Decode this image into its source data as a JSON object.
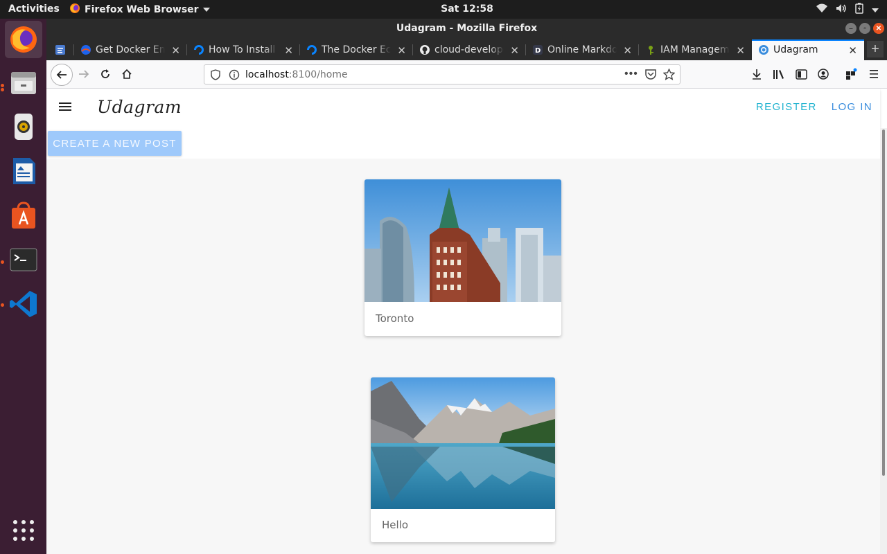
{
  "topbar": {
    "activities": "Activities",
    "app_name": "Firefox Web Browser",
    "clock": "Sat 12:58"
  },
  "window": {
    "title": "Udagram - Mozilla Firefox"
  },
  "tabs": [
    {
      "label": "Get Docker Eng",
      "icon": "docker-docs-icon"
    },
    {
      "label": "How To Install a",
      "icon": "digitalocean-icon"
    },
    {
      "label": "The Docker Eco",
      "icon": "digitalocean-icon"
    },
    {
      "label": "cloud-develope",
      "icon": "github-icon"
    },
    {
      "label": "Online Markdo",
      "icon": "dillinger-icon"
    },
    {
      "label": "IAM Manageme",
      "icon": "aws-iam-icon"
    },
    {
      "label": "Udagram",
      "icon": "udagram-icon",
      "selected": true
    }
  ],
  "urlbar": {
    "host": "localhost",
    "rest": ":8100/home"
  },
  "app": {
    "brand": "Udagram",
    "register": "REGISTER",
    "login": "LOG IN",
    "create_post": "CREATE A NEW POST"
  },
  "feed": [
    {
      "caption": "Toronto",
      "image": "toronto-skyline-photo"
    },
    {
      "caption": "Hello",
      "image": "mountain-lake-photo"
    }
  ],
  "colors": {
    "accent_blue": "#0a84ff",
    "register_teal": "#1eb2cf",
    "login_blue": "#3a8ddd",
    "create_button": "#9ec9fb",
    "dock_bg": "#3b1e33",
    "ubuntu_orange": "#e95420"
  }
}
